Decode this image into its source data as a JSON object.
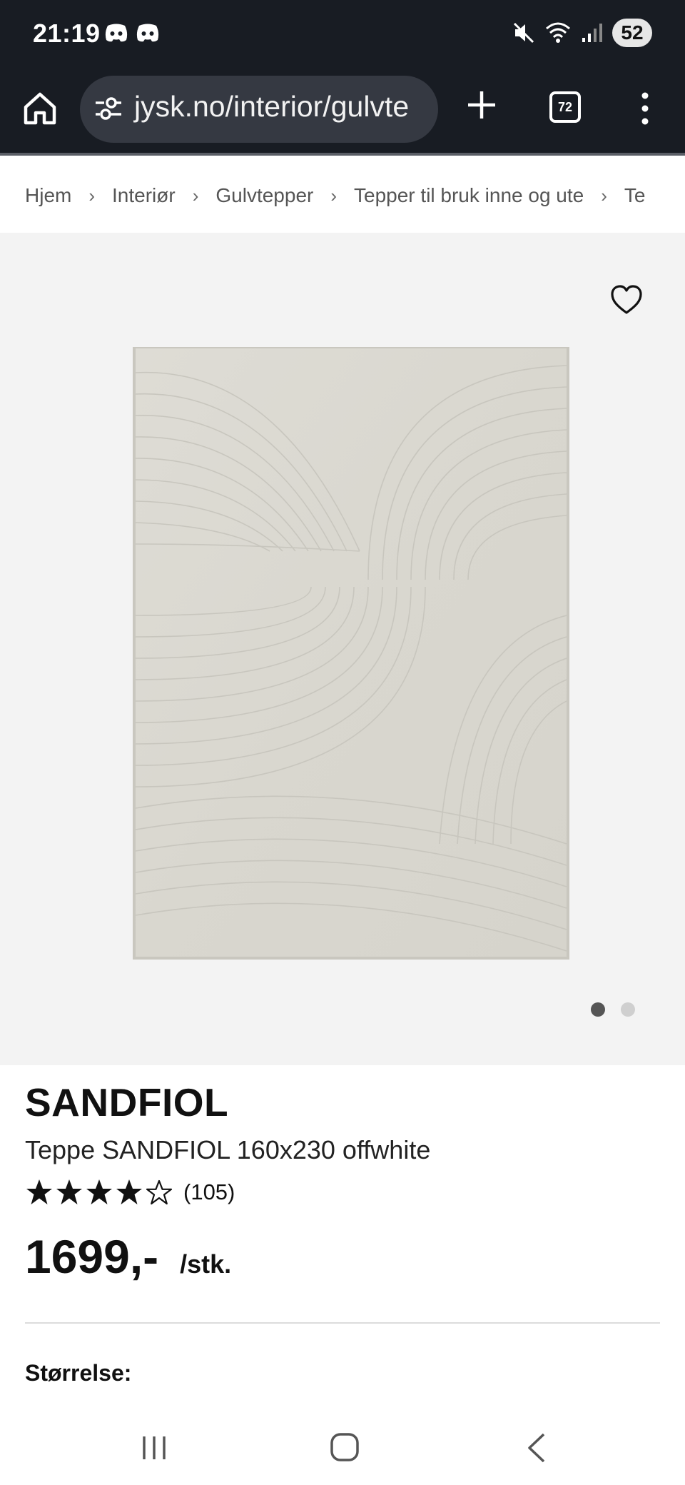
{
  "status_bar": {
    "time": "21:19",
    "battery": "52",
    "icons": [
      "discord-icon",
      "discord-icon",
      "mute-icon",
      "wifi-icon",
      "signal-icon"
    ]
  },
  "browser": {
    "url": "jysk.no/interior/gulvte",
    "tab_count": "72",
    "icons": [
      "home-icon",
      "site-settings-icon",
      "new-tab-icon",
      "tabs-icon",
      "menu-icon"
    ]
  },
  "breadcrumb": {
    "items": [
      "Hjem",
      "Interiør",
      "Gulvtepper",
      "Tepper til bruk inne og ute",
      "Te"
    ]
  },
  "gallery": {
    "image_count": 2,
    "active_index": 0,
    "image_semantic": "rug-image"
  },
  "product": {
    "brand": "SANDFIOL",
    "name": "Teppe SANDFIOL 160x230 offwhite",
    "rating_value": 4,
    "rating_max": 5,
    "review_count": "(105)",
    "price": "1699,-",
    "unit": "/stk.",
    "size_label": "Størrelse:"
  },
  "colors": {
    "chrome_dark": "#181c23",
    "url_box": "#353942",
    "gallery_bg": "#f3f3f3",
    "rug": "#dcdad3"
  }
}
